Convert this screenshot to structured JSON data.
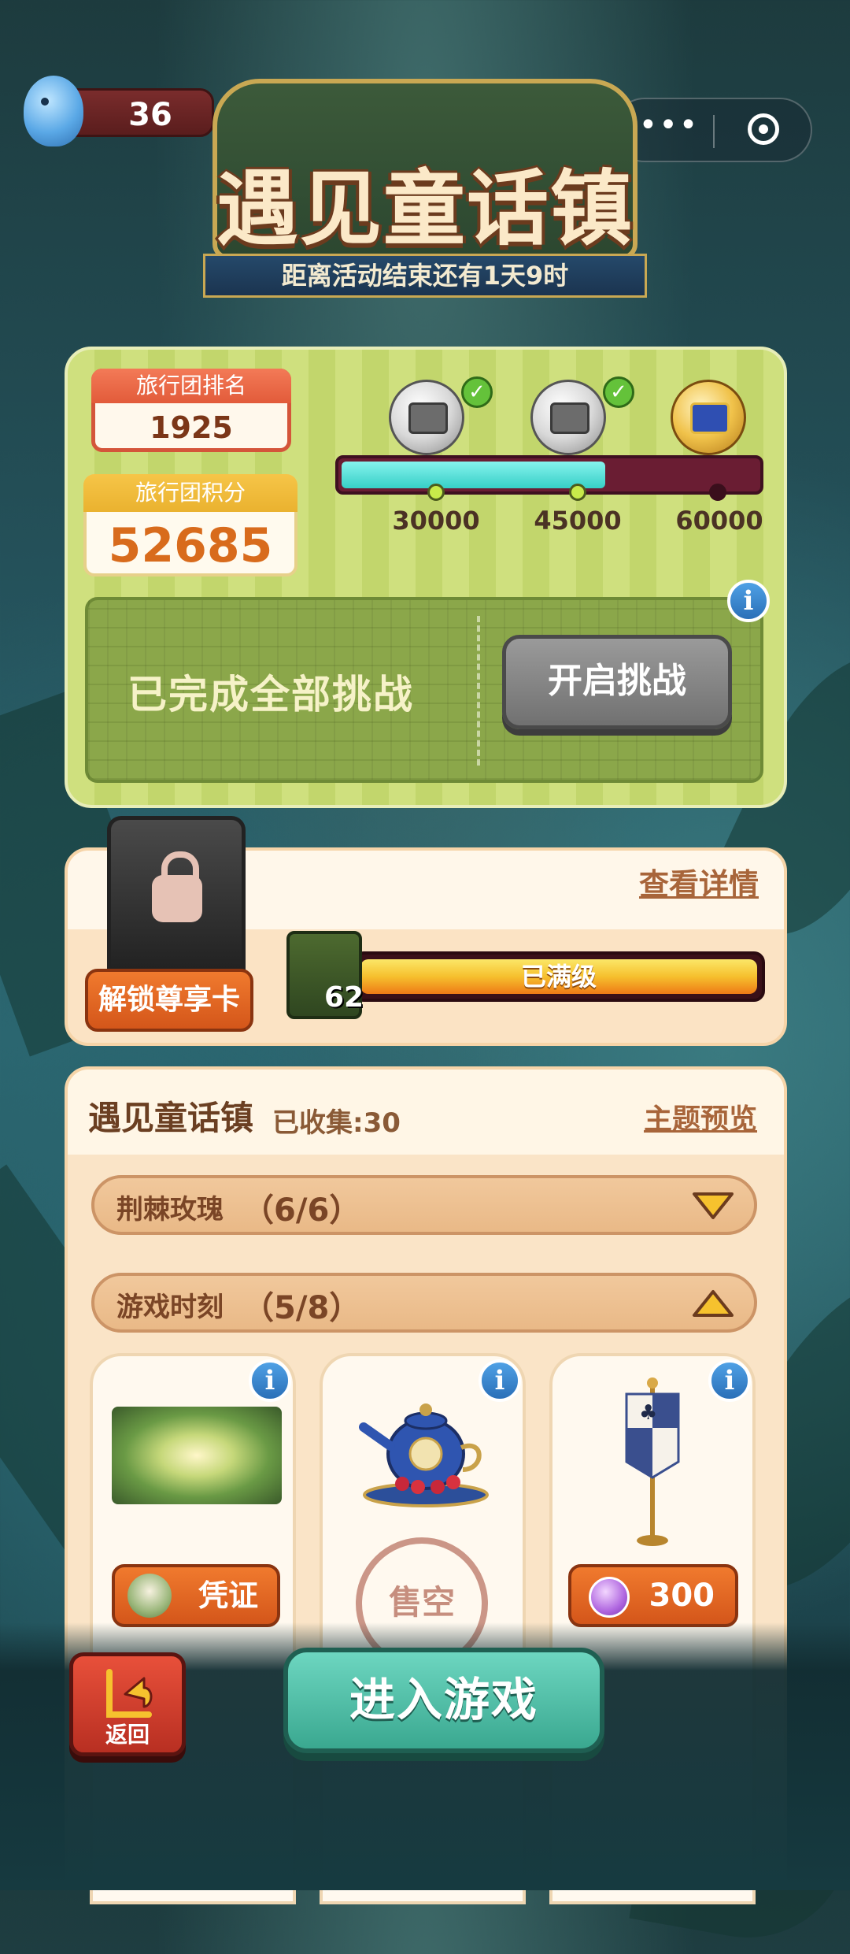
{
  "header": {
    "currency_count": "36",
    "menu_dots": "•••",
    "title": "遇见童话镇",
    "countdown": "距离活动结束还有1天9时"
  },
  "team": {
    "rank_label": "旅行团排名",
    "rank_value": "1925",
    "score_label": "旅行团积分",
    "score_value": "52685",
    "progress": {
      "current": 52685,
      "max": 60000,
      "milestones": [
        "30000",
        "45000",
        "60000"
      ],
      "milestone_claimed": [
        true,
        true,
        false
      ]
    },
    "challenge_status": "已完成全部挑战",
    "start_challenge_label": "开启挑战",
    "info_icon": "i"
  },
  "pass": {
    "details_link": "查看详情",
    "unlock_label": "解锁尊享卡",
    "level": "62",
    "level_status": "已满级",
    "level_progress": 1.0
  },
  "collection": {
    "title": "遇见童话镇",
    "collected": "已收集:30",
    "preview_link": "主题预览",
    "groups": [
      {
        "name": "荆棘玫瑰",
        "count": "（6/6）",
        "expanded": false
      },
      {
        "name": "游戏时刻",
        "count": "（5/8）",
        "expanded": true
      }
    ],
    "items": [
      {
        "icon": "forest-scene",
        "action_label": "凭证",
        "info": "i"
      },
      {
        "icon": "teapot",
        "stamp_label": "售空",
        "info": "i"
      },
      {
        "icon": "card-suit-banner",
        "price": "300",
        "info": "i"
      }
    ]
  },
  "footer": {
    "back_label": "返回",
    "enter_label": "进入游戏"
  },
  "colors": {
    "accent_teal": "#3aa890",
    "orange_button": "#e0621f",
    "panel_green": "#c8db74",
    "panel_cream": "#fbe3c4"
  }
}
